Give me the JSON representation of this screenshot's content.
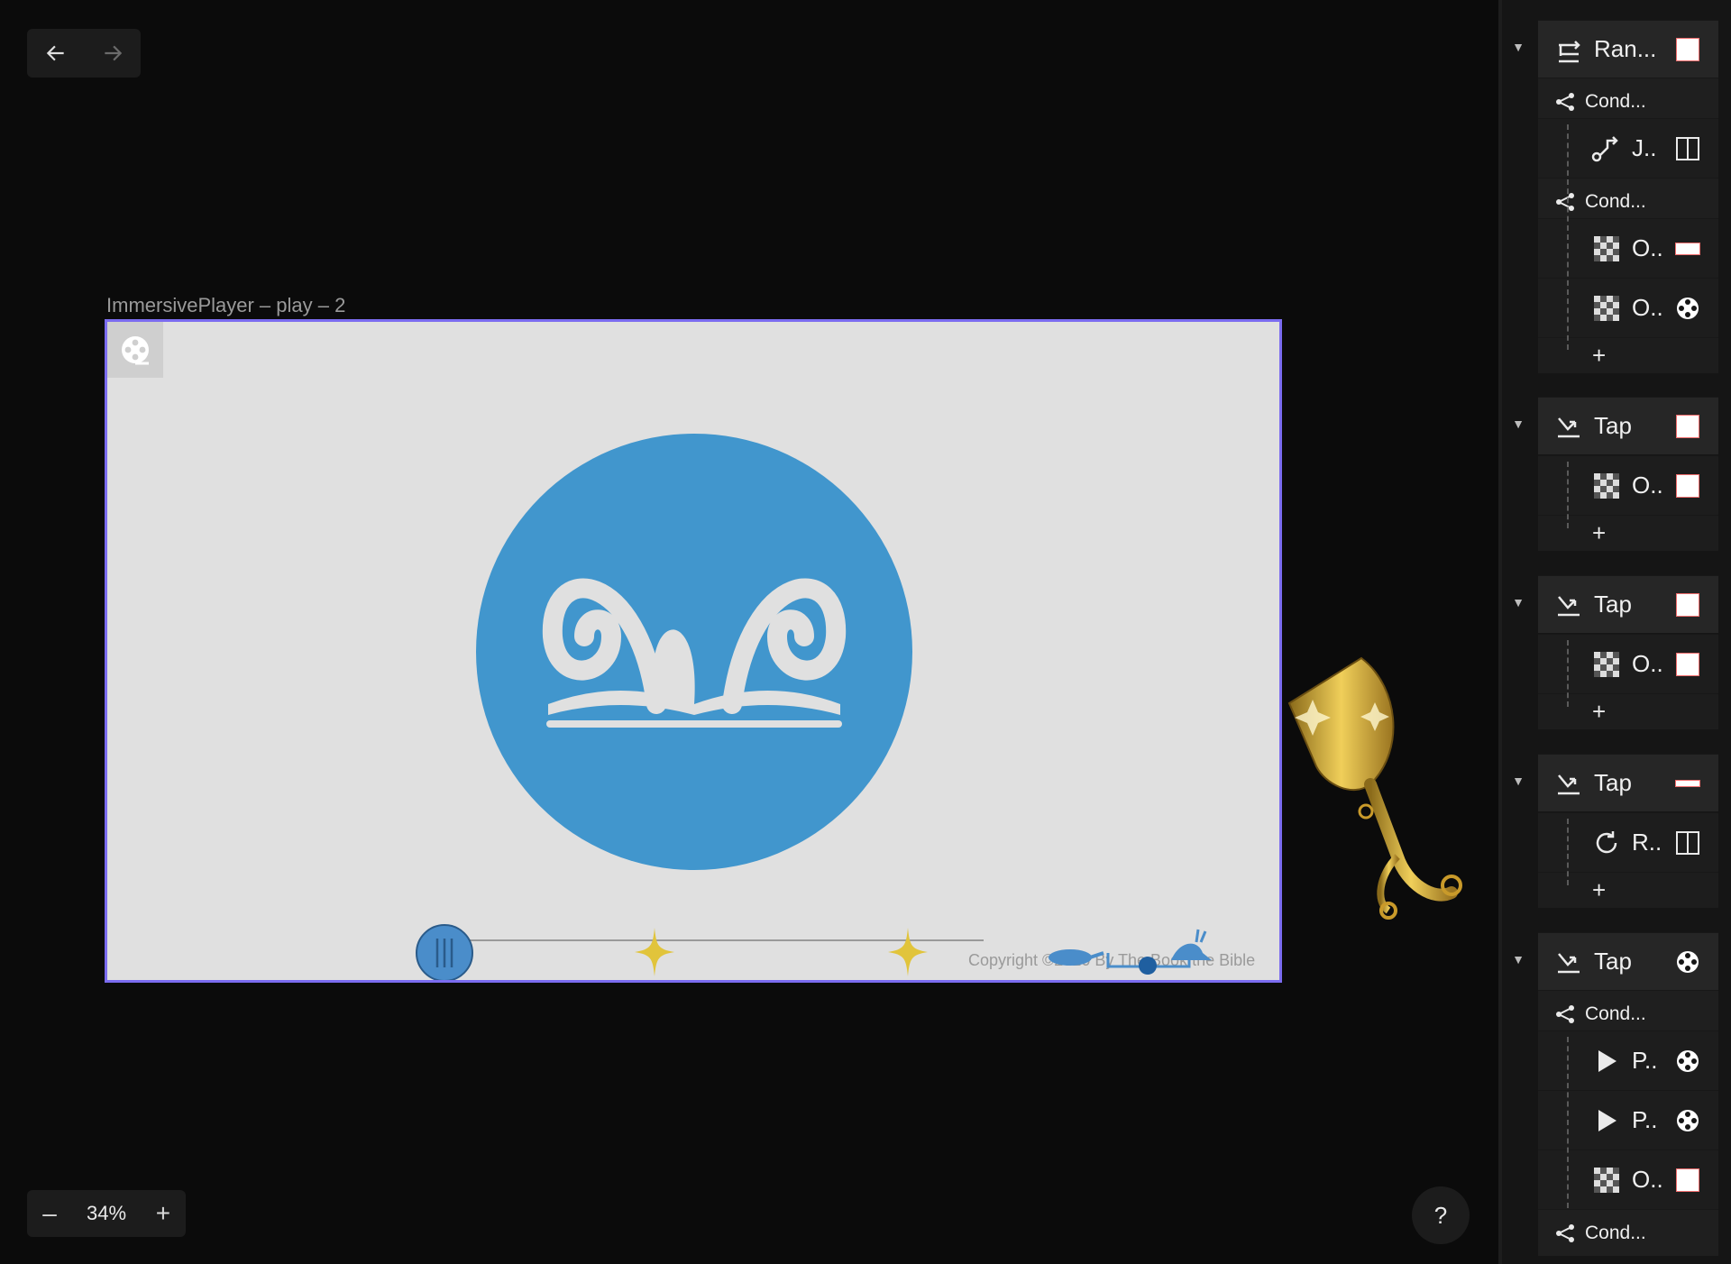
{
  "canvas": {
    "frame_title": "ImmersivePlayer – play – 2",
    "copyright": "Copyright ©2020 By The Book the Bible"
  },
  "zoom": {
    "level": "34%",
    "minus": "–",
    "plus": "+"
  },
  "help": {
    "label": "?"
  },
  "colors": {
    "frame_border": "#7b6cf0",
    "logo_blue": "#4196cd",
    "panel_bg": "#151515"
  },
  "panel": {
    "groups": [
      {
        "head": "Ran...",
        "rows": [
          {
            "cond": "Cond..."
          },
          {
            "item": "J.."
          },
          {
            "cond": "Cond..."
          },
          {
            "item": "O.."
          },
          {
            "item": "O.."
          }
        ]
      },
      {
        "head": "Tap",
        "rows": [
          {
            "item": "O.."
          }
        ]
      },
      {
        "head": "Tap",
        "rows": [
          {
            "item": "O.."
          }
        ]
      },
      {
        "head": "Tap",
        "rows": [
          {
            "item": "R.."
          }
        ]
      },
      {
        "head": "Tap",
        "rows": [
          {
            "cond": "Cond..."
          },
          {
            "item": "P.."
          },
          {
            "item": "P.."
          },
          {
            "item": "O.."
          },
          {
            "cond": "Cond..."
          }
        ]
      }
    ]
  }
}
